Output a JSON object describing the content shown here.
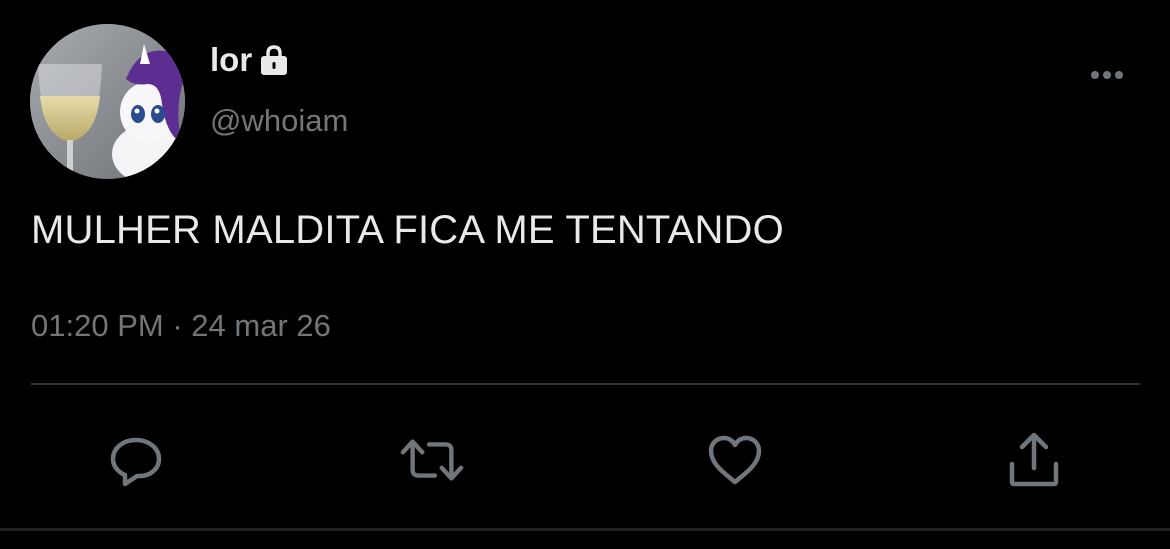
{
  "tweet": {
    "display_name": "lor",
    "handle": "@whoiam",
    "text": "MULHER MALDITA FICA ME TENTANDO",
    "time": "01:20 PM",
    "separator": "·",
    "date": "24 mar 26"
  },
  "icons": {
    "lock": "lock-icon",
    "more": "more-horizontal-icon",
    "reply": "reply-icon",
    "retweet": "retweet-icon",
    "like": "heart-icon",
    "share": "share-icon"
  },
  "colors": {
    "background": "#000000",
    "text_primary": "#e7e9ea",
    "text_secondary": "#71767b",
    "divider": "#2f3336"
  }
}
